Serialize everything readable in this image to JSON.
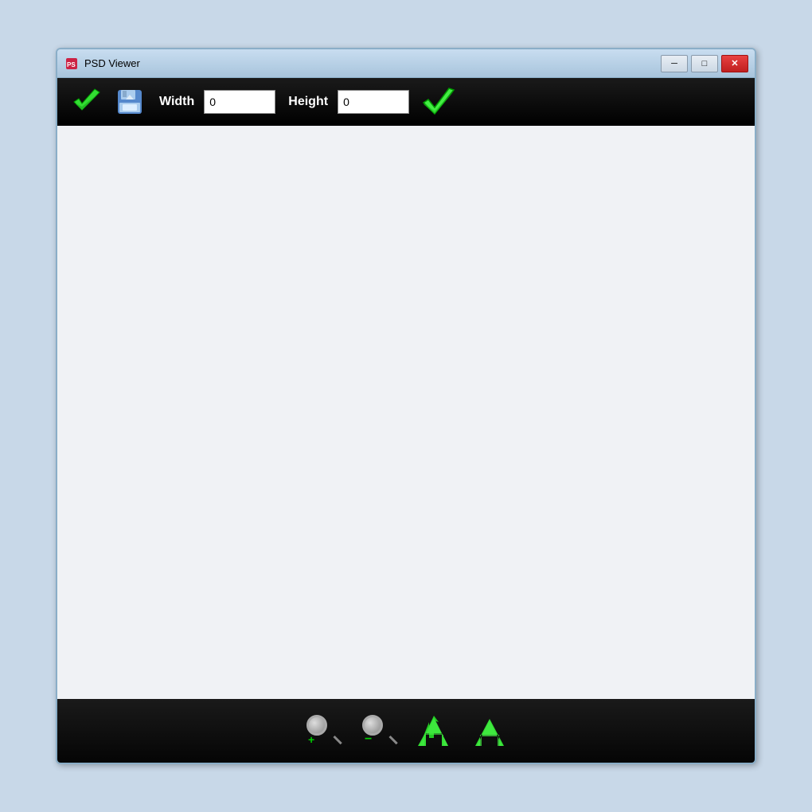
{
  "window": {
    "title": "PSD Viewer",
    "icon": "psd-viewer-icon"
  },
  "titlebar": {
    "minimize_label": "─",
    "restore_label": "□",
    "close_label": "✕"
  },
  "toolbar": {
    "width_label": "Width",
    "width_value": "0",
    "width_placeholder": "0",
    "height_label": "Height",
    "height_value": "0",
    "height_placeholder": "0"
  },
  "bottom_toolbar": {
    "zoom_in_label": "zoom-in",
    "zoom_out_label": "zoom-out",
    "rotate_left_label": "rotate-left",
    "rotate_right_label": "rotate-right"
  },
  "colors": {
    "toolbar_bg": "#000000",
    "canvas_bg": "#f0f2f5",
    "green_accent": "#22cc22",
    "title_bar_bg": "#b8cfe0"
  }
}
